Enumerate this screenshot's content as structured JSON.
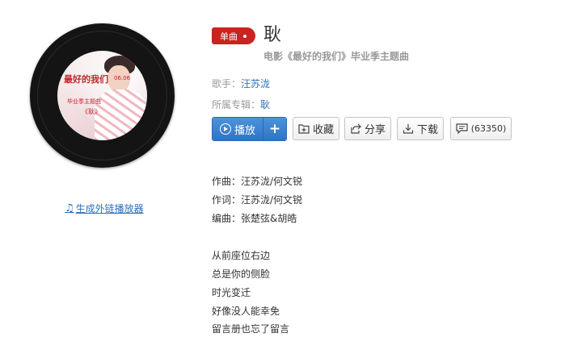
{
  "cover": {
    "title_text": "最好的我们",
    "date_text": "06.06",
    "subtitle_text": "毕业季主题曲",
    "song_text": "《耿》"
  },
  "player_link": "生成外链播放器",
  "badge": "单曲",
  "song": {
    "title": "耿",
    "subtitle": "电影《最好的我们》毕业季主题曲"
  },
  "meta": {
    "singer_label": "歌手：",
    "singer": "汪苏泷",
    "album_label": "所属专辑：",
    "album": "耿"
  },
  "buttons": {
    "play": "播放",
    "add": "+",
    "favorite": "收藏",
    "share": "分享",
    "download": "下载",
    "comments": "(63350)"
  },
  "lyrics": {
    "credits": [
      "作曲：汪苏泷/何文锐",
      "作词：汪苏泷/何文锐",
      "编曲：张楚弦&胡皓"
    ],
    "lines": [
      "从前座位右边",
      "总是你的侧脸",
      "时光变迁",
      "好像没人能幸免",
      "留言册也忘了留言"
    ]
  }
}
